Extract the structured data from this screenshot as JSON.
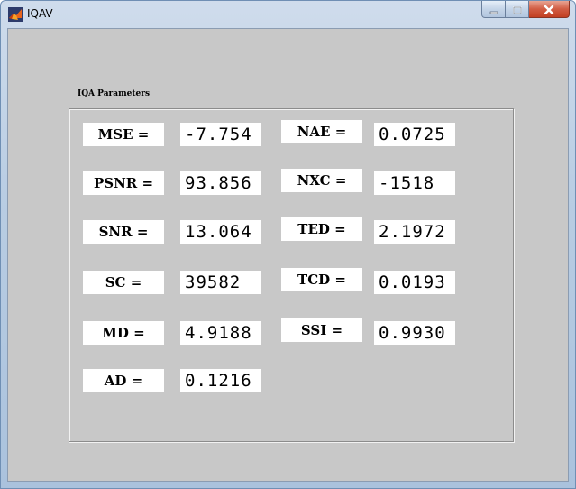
{
  "window": {
    "title": "IQAV",
    "buttons": {
      "minimize": "minimize-icon",
      "maximize": "maximize-icon",
      "close": "close-icon"
    }
  },
  "panel": {
    "title": "IQA Parameters",
    "left": [
      {
        "label": "MSE =",
        "value": "-7.754"
      },
      {
        "label": "PSNR =",
        "value": "93.856"
      },
      {
        "label": "SNR =",
        "value": "13.064"
      },
      {
        "label": "SC =",
        "value": "39582"
      },
      {
        "label": "MD =",
        "value": "4.9188"
      },
      {
        "label": "AD =",
        "value": "0.1216"
      }
    ],
    "right": [
      {
        "label": "NAE =",
        "value": "0.0725"
      },
      {
        "label": "NXC =",
        "value": "-1518"
      },
      {
        "label": "TED =",
        "value": "2.1972"
      },
      {
        "label": "TCD =",
        "value": "0.0193"
      },
      {
        "label": "SSI =",
        "value": "0.9930"
      }
    ]
  }
}
